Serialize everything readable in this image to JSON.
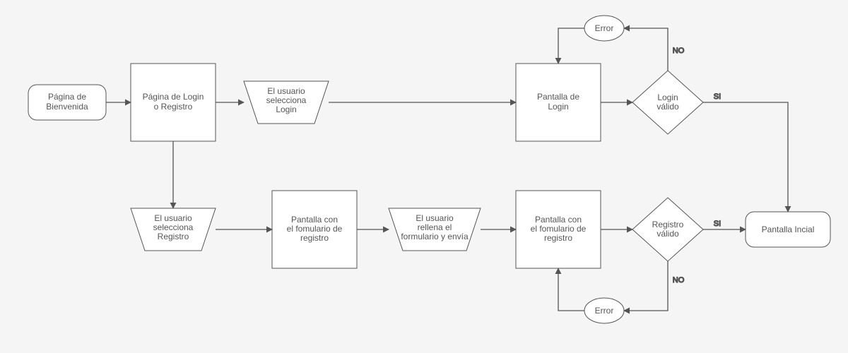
{
  "nodes": {
    "welcome": {
      "label": "Página de\nBienvenida"
    },
    "login_or_reg": {
      "label": "Página de Login\no Registro"
    },
    "select_login": {
      "label": "El usuario\nselecciona\nLogin"
    },
    "login_screen": {
      "label": "Pantalla de\nLogin"
    },
    "login_valid": {
      "label": "Login\nválido"
    },
    "login_error": {
      "label": "Error"
    },
    "select_reg": {
      "label": "El usuario\nselecciona\nRegistro"
    },
    "reg_form": {
      "label": "Pantalla con\nel fomulario de\nregistro"
    },
    "fill_send": {
      "label": "El usuario\nrellena el\nformulario y envía"
    },
    "reg_form2": {
      "label": "Pantalla con\nel fomulario de\nregistro"
    },
    "reg_valid": {
      "label": "Registro\nválido"
    },
    "reg_error": {
      "label": "Error"
    },
    "initial": {
      "label": "Pantalla Incial"
    }
  },
  "edge_labels": {
    "login_no": "NO",
    "login_si": "SI",
    "reg_si": "SI",
    "reg_no": "NO"
  }
}
